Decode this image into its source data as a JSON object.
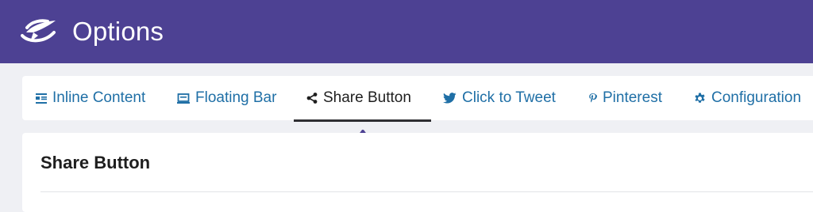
{
  "header": {
    "title": "Options",
    "logo_icon": "paper-plane-orbit-logo"
  },
  "tabs": [
    {
      "label": "Inline Content",
      "icon": "inline-content-icon",
      "active": false
    },
    {
      "label": "Floating Bar",
      "icon": "floating-bar-icon",
      "active": false
    },
    {
      "label": "Share Button",
      "icon": "share-icon",
      "active": true
    },
    {
      "label": "Click to Tweet",
      "icon": "twitter-icon",
      "active": false
    },
    {
      "label": "Pinterest",
      "icon": "pinterest-icon",
      "active": false
    },
    {
      "label": "Configuration",
      "icon": "gear-icon",
      "active": false
    }
  ],
  "panel": {
    "title": "Share Button"
  },
  "colors": {
    "header_bg": "#4d4193",
    "tab_link": "#1f6fa6",
    "active_text": "#1e1e1e",
    "annotation_arrow": "#4d4193"
  }
}
